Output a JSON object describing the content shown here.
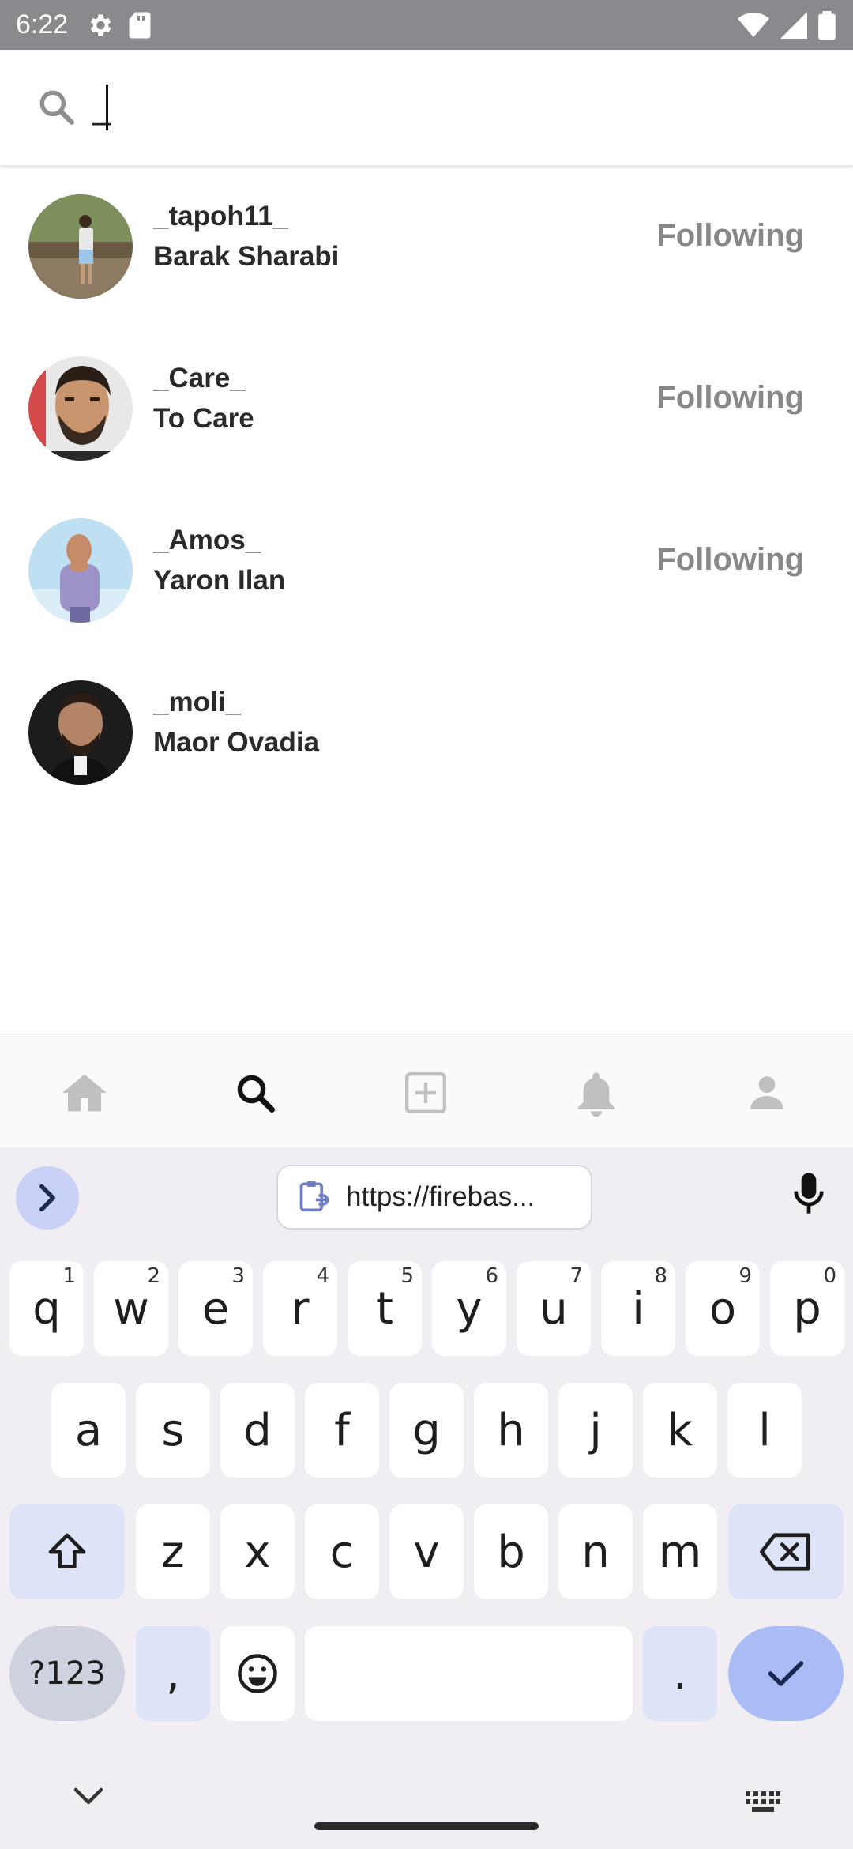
{
  "status_bar": {
    "time": "6:22"
  },
  "search": {
    "value": "_",
    "placeholder": ""
  },
  "users": [
    {
      "username": "_tapoh11_",
      "full_name": "Barak Sharabi",
      "follow_label": "Following"
    },
    {
      "username": "_Care_",
      "full_name": "To Care",
      "follow_label": "Following"
    },
    {
      "username": "_Amos_",
      "full_name": "Yaron Ilan",
      "follow_label": "Following"
    },
    {
      "username": "_moli_",
      "full_name": "Maor Ovadia",
      "follow_label": ""
    }
  ],
  "bottom_nav": {
    "items": [
      "home-icon",
      "search-icon",
      "add-post-icon",
      "notifications-icon",
      "profile-icon"
    ],
    "active": "search-icon"
  },
  "keyboard": {
    "clipboard_text": "https://firebas...",
    "row1": [
      {
        "key": "q",
        "hint": "1"
      },
      {
        "key": "w",
        "hint": "2"
      },
      {
        "key": "e",
        "hint": "3"
      },
      {
        "key": "r",
        "hint": "4"
      },
      {
        "key": "t",
        "hint": "5"
      },
      {
        "key": "y",
        "hint": "6"
      },
      {
        "key": "u",
        "hint": "7"
      },
      {
        "key": "i",
        "hint": "8"
      },
      {
        "key": "o",
        "hint": "9"
      },
      {
        "key": "p",
        "hint": "0"
      }
    ],
    "row2": [
      "a",
      "s",
      "d",
      "f",
      "g",
      "h",
      "j",
      "k",
      "l"
    ],
    "row3": [
      "z",
      "x",
      "c",
      "v",
      "b",
      "n",
      "m"
    ],
    "symbols_label": "?123",
    "comma": ",",
    "period": "."
  },
  "colors": {
    "status_bar": "#8a8a8e",
    "follow_text": "#888888",
    "keyboard_bg": "#f0eef3",
    "keyboard_mod": "#dde4f8",
    "keyboard_accent": "#a9bcf5"
  }
}
